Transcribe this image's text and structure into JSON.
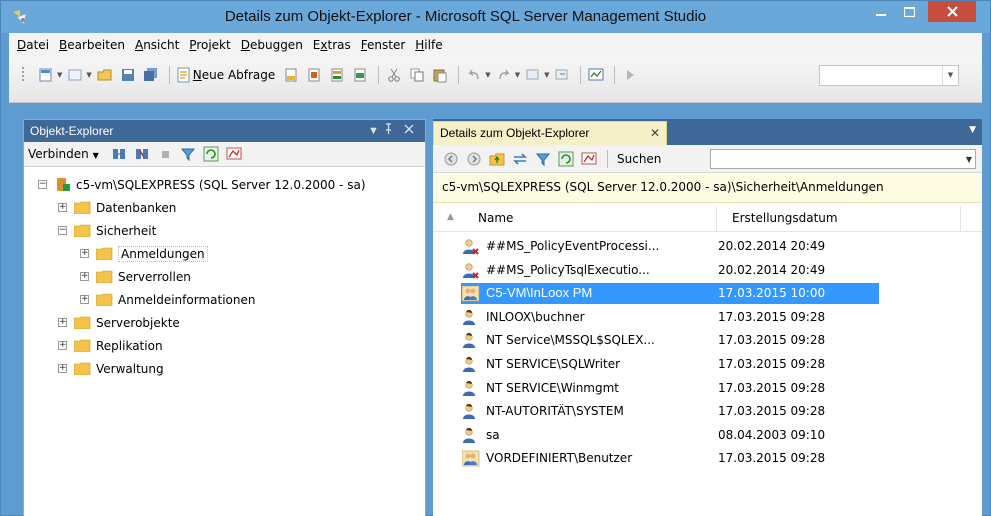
{
  "window": {
    "title": "Details zum Objekt-Explorer - Microsoft SQL Server Management Studio",
    "accent": "#6aa8da",
    "close_color": "#c74d3e"
  },
  "menu": [
    {
      "label": "Datei",
      "accel": "D",
      "rest": "atei"
    },
    {
      "label": "Bearbeiten",
      "accel": "B",
      "rest": "earbeiten"
    },
    {
      "label": "Ansicht",
      "accel": "A",
      "rest": "nsicht"
    },
    {
      "label": "Projekt",
      "accel": "P",
      "rest": "rojekt"
    },
    {
      "label": "Debuggen",
      "accel": "D",
      "rest": "ebuggen"
    },
    {
      "label": "Extras",
      "accel": "x",
      "pre": "E",
      "rest": "tras"
    },
    {
      "label": "Fenster",
      "accel": "F",
      "rest": "enster"
    },
    {
      "label": "Hilfe",
      "accel": "H",
      "rest": "ilfe"
    }
  ],
  "toolbar": {
    "new_query_accel": "N",
    "new_query_rest": "eue Abfrage"
  },
  "object_explorer": {
    "title": "Objekt-Explorer",
    "pin_icon": "pin-icon",
    "close_icon": "close-icon",
    "connect_label": "Verbinden",
    "server_node": "c5-vm\\SQLEXPRESS (SQL Server 12.0.2000 - sa)",
    "nodes": {
      "databases": "Datenbanken",
      "security": "Sicherheit",
      "logins": "Anmeldungen",
      "server_roles": "Serverrollen",
      "credentials": "Anmeldeinformationen",
      "server_objects": "Serverobjekte",
      "replication": "Replikation",
      "management": "Verwaltung"
    }
  },
  "details": {
    "tab_label": "Details zum Objekt-Explorer",
    "search_label": "Suchen",
    "search_value": "",
    "path": "c5-vm\\SQLEXPRESS (SQL Server 12.0.2000 - sa)\\Sicherheit\\Anmeldungen",
    "columns": {
      "name": "Name",
      "created": "Erstellungsdatum"
    },
    "rows": [
      {
        "name": "##MS_PolicyEventProcessi...",
        "date": "20.02.2014 20:49",
        "icon": "login-disabled-icon"
      },
      {
        "name": "##MS_PolicyTsqlExecutio...",
        "date": "20.02.2014 20:49",
        "icon": "login-disabled-icon"
      },
      {
        "name": "C5-VM\\InLoox PM",
        "date": "17.03.2015 10:00",
        "icon": "windows-group-icon",
        "selected": true
      },
      {
        "name": "INLOOX\\buchner",
        "date": "17.03.2015 09:28",
        "icon": "login-icon"
      },
      {
        "name": "NT Service\\MSSQL$SQLEX...",
        "date": "17.03.2015 09:28",
        "icon": "login-icon"
      },
      {
        "name": "NT SERVICE\\SQLWriter",
        "date": "17.03.2015 09:28",
        "icon": "login-icon"
      },
      {
        "name": "NT SERVICE\\Winmgmt",
        "date": "17.03.2015 09:28",
        "icon": "login-icon"
      },
      {
        "name": "NT-AUTORITÄT\\SYSTEM",
        "date": "17.03.2015 09:28",
        "icon": "login-icon"
      },
      {
        "name": "sa",
        "date": "08.04.2003 09:10",
        "icon": "login-icon"
      },
      {
        "name": "VORDEFINIERT\\Benutzer",
        "date": "17.03.2015 09:28",
        "icon": "windows-group-icon"
      }
    ]
  }
}
